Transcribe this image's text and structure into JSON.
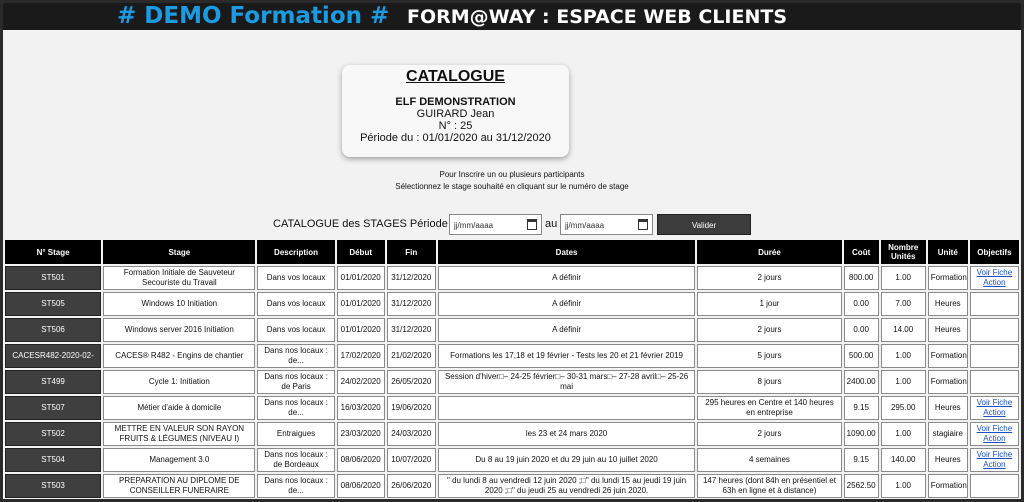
{
  "header": {
    "brand": "# DEMO Formation #",
    "portal": "FORM@WAY : ESPACE WEB CLIENTS"
  },
  "card": {
    "title": "CATALOGUE",
    "company": "ELF DEMONSTRATION",
    "contact": "GUIRARD Jean",
    "number": "N° : 25",
    "period": "Période du : 01/01/2020 au 31/12/2020"
  },
  "instructions": {
    "line1": "Pour Inscrire un ou plusieurs participants",
    "line2": "Sélectionnez le stage souhaité en cliquant sur le numéro de stage"
  },
  "filter": {
    "label": "CATALOGUE des STAGES Période du",
    "and_label": "au",
    "date_placeholder": "jj/mm/aaaa",
    "submit": "Valider"
  },
  "table": {
    "headers": [
      "N° Stage",
      "Stage",
      "Description",
      "Début",
      "Fin",
      "Dates",
      "Durée",
      "Coût",
      "Nombre Unités",
      "Unité",
      "Objectifs"
    ],
    "rows": [
      {
        "num": "ST501",
        "stage": "Formation Initiale de Sauveteur Secouriste du Travail",
        "desc": "Dans vos locaux",
        "debut": "01/01/2020",
        "fin": "31/12/2020",
        "dates": "A définir",
        "duree": "2 jours",
        "cout": "800.00",
        "nb": "1.00",
        "unite": "Formation",
        "obj": "Voir Fiche Action"
      },
      {
        "num": "ST505",
        "stage": "Windows 10 Initiation",
        "desc": "Dans vos locaux",
        "debut": "01/01/2020",
        "fin": "31/12/2020",
        "dates": "A définir",
        "duree": "1 jour",
        "cout": "0.00",
        "nb": "7.00",
        "unite": "Heures",
        "obj": ""
      },
      {
        "num": "ST506",
        "stage": "Windows server 2016 Initiation",
        "desc": "Dans vos locaux",
        "debut": "01/01/2020",
        "fin": "31/12/2020",
        "dates": "A définir",
        "duree": "2 jours",
        "cout": "0.00",
        "nb": "14.00",
        "unite": "Heures",
        "obj": ""
      },
      {
        "num": "CACESR482-2020-02-",
        "stage": "CACES® R482 - Engins de chantier",
        "desc": "Dans nos locaux : de...",
        "debut": "17/02/2020",
        "fin": "21/02/2020",
        "dates": "Formations les 17,18 et 19 février - Tests les 20 et 21 février 2019",
        "duree": "5 jours",
        "cout": "500.00",
        "nb": "1.00",
        "unite": "Formation",
        "obj": ""
      },
      {
        "num": "ST499",
        "stage": "Cycle 1: Initiation",
        "desc": "Dans nos locaux : de Paris",
        "debut": "24/02/2020",
        "fin": "26/05/2020",
        "dates": "Session d'hiver□– 24-25 février□– 30-31 mars□– 27-28 avril□– 25-26 mai",
        "duree": "8 jours",
        "cout": "2400.00",
        "nb": "1.00",
        "unite": "Formation",
        "obj": ""
      },
      {
        "num": "ST507",
        "stage": "Métier d'aide à domicile",
        "desc": "Dans nos locaux : de...",
        "debut": "16/03/2020",
        "fin": "19/06/2020",
        "dates": "",
        "duree": "295 heures en Centre et 140 heures en entreprise",
        "cout": "9.15",
        "nb": "295.00",
        "unite": "Heures",
        "obj": "Voir Fiche Action"
      },
      {
        "num": "ST502",
        "stage": "METTRE EN VALEUR SON RAYON FRUITS & LÉGUMES (NIVEAU I)",
        "desc": "Entraigues",
        "debut": "23/03/2020",
        "fin": "24/03/2020",
        "dates": "les 23 et 24 mars 2020",
        "duree": "2 jours",
        "cout": "1090.00",
        "nb": "1.00",
        "unite": "stagiaire",
        "obj": "Voir Fiche Action"
      },
      {
        "num": "ST504",
        "stage": "Management 3.0",
        "desc": "Dans nos locaux : de Bordeaux",
        "debut": "08/06/2020",
        "fin": "10/07/2020",
        "dates": "Du 8 au 19 juin 2020 et du 29 juin au 10 juillet 2020",
        "duree": "4 semaines",
        "cout": "9.15",
        "nb": "140.00",
        "unite": "Heures",
        "obj": "Voir Fiche Action"
      },
      {
        "num": "ST503",
        "stage": "PREPARATION AU DIPLOME DE CONSEILLER FUNERAIRE",
        "desc": "Dans nos locaux : de...",
        "debut": "08/06/2020",
        "fin": "26/06/2020",
        "dates": "\" du lundi 8 au vendredi 12 juin 2020 ;□\" du lundi 15 au jeudi 19 juin 2020 ;□\" du jeudi 25 au vendredi 26 juin 2020.",
        "duree": "147 heures (dont 84h en présentiel et 63h en ligne et à distance)",
        "cout": "2562.50",
        "nb": "1.00",
        "unite": "Formation",
        "obj": ""
      }
    ]
  },
  "colors": {
    "brand_blue": "#1b9ce2",
    "header_bg": "#1a1a1a",
    "stage_number_bg": "#3f3f3f",
    "link": "#1a4fc7"
  },
  "icons": {
    "date_picker": "calendar-icon"
  }
}
